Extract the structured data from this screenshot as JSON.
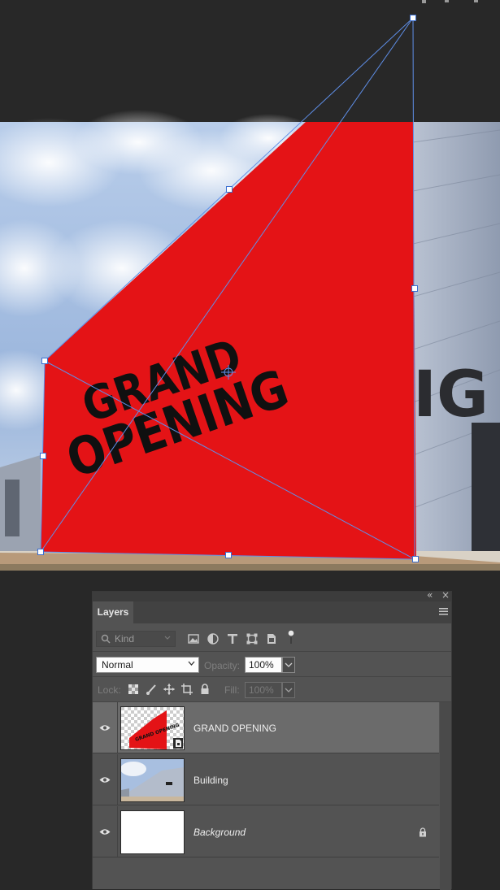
{
  "canvas": {
    "sign_text_line1": "GRAND",
    "sign_text_line2": "OPENING",
    "building_text_fragment": "IG",
    "sign_color": "#e41316",
    "sky_color": "#a7c0e2",
    "building_color": "#a9b4c6",
    "transform_line_color": "#5f8fe8"
  },
  "layers_panel": {
    "tab_label": "Layers",
    "filter_kind_placeholder": "Kind",
    "blend_mode": "Normal",
    "opacity_label": "Opacity:",
    "opacity_value": "100%",
    "lock_label": "Lock:",
    "fill_label": "Fill:",
    "fill_value": "100%",
    "layers": [
      {
        "name": "GRAND OPENING",
        "selected": true,
        "visible": true,
        "smart_object": true
      },
      {
        "name": "Building",
        "selected": false,
        "visible": true
      },
      {
        "name": "Background",
        "selected": false,
        "visible": true,
        "locked": true
      }
    ]
  },
  "icons": {
    "panel_collapse": "double-chevron-left-icon",
    "panel_close": "close-icon",
    "panel_menu": "hamburger-menu-icon",
    "filters": [
      "image-filter-icon",
      "adjustment-filter-icon",
      "type-filter-icon",
      "shape-filter-icon",
      "smart-object-filter-icon",
      "filter-toggle-icon"
    ],
    "locks": [
      "lock-transparent-pixels-icon",
      "lock-image-pixels-icon",
      "lock-position-icon",
      "lock-artboard-icon",
      "lock-all-icon"
    ]
  }
}
